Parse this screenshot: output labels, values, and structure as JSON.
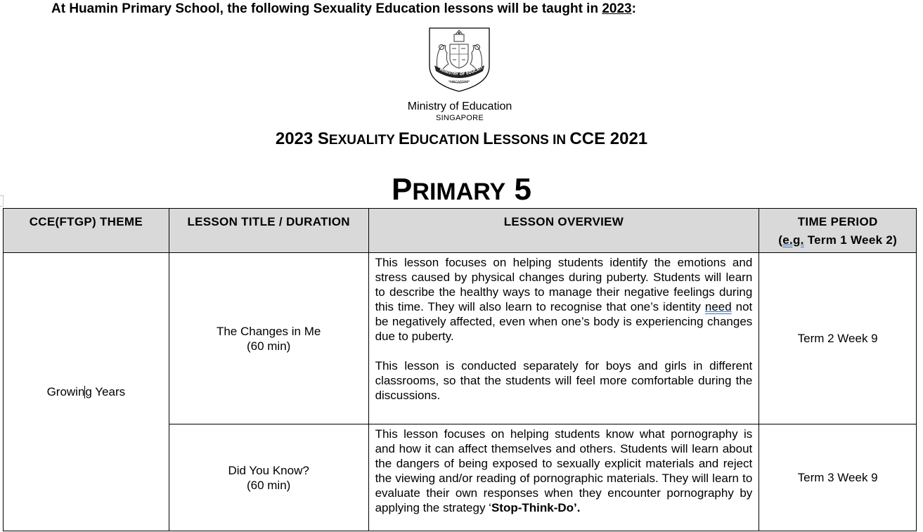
{
  "intro": {
    "before": "At Huamin Primary School, the following Sexuality Education lessons will be taught in ",
    "year": "2023",
    "after": ":"
  },
  "crest": {
    "icon": "moe-singapore-crest-icon",
    "ribbon_text": "MINISTRY OF EDUCATION",
    "scroll_text": "SINGAPORE"
  },
  "ministry": {
    "name": "Ministry of Education",
    "country": "SINGAPORE"
  },
  "title": {
    "year": "2023 ",
    "w1_cap": "S",
    "w1_rest": "EXUALITY ",
    "w2_cap": "E",
    "w2_rest": "DUCATION ",
    "w3_cap": "L",
    "w3_rest": "ESSONS ",
    "w4": "IN ",
    "w5": "CCE 2021"
  },
  "level": {
    "cap": "P",
    "rest": "RIMARY",
    "num": " 5"
  },
  "table": {
    "headers": {
      "theme": "CCE(FTGP) THEME",
      "lesson": "LESSON TITLE / DURATION",
      "overview": "LESSON OVERVIEW",
      "time_line1": "TIME PERIOD",
      "time_eg": "e.g.",
      "time_rest": " Term 1 Week 2)"
    },
    "theme_before_cursor": "Growin",
    "theme_after_cursor": "g Years",
    "rows": [
      {
        "title": "The Changes in Me",
        "duration": "(60 min)",
        "overview_p1_a": "This lesson focuses on helping students identify the emotions and stress caused by physical changes during puberty. Students will learn to describe the healthy ways to manage their negative feelings during this time. They will also learn to recognise that one’s identity ",
        "overview_p1_need": "need",
        "overview_p1_b": " not be negatively affected, even when one’s body is experiencing changes due to puberty.",
        "overview_p2": "This lesson is conducted separately for boys and girls in different classrooms, so that the students will feel more comfortable during the discussions.",
        "time": "Term 2 Week 9"
      },
      {
        "title": "Did You Know?",
        "duration": "(60 min)",
        "overview_a": "This lesson focuses on helping students know what pornography is and how it can affect themselves and others. Students will learn about the dangers of being exposed to sexually explicit materials and reject the viewing and/or reading of pornographic materials. They will learn to evaluate their own responses when they encounter pornography by applying the strategy ‘",
        "overview_bold": "Stop-Think-Do’.",
        "time": "Term 3 Week 9"
      }
    ]
  }
}
